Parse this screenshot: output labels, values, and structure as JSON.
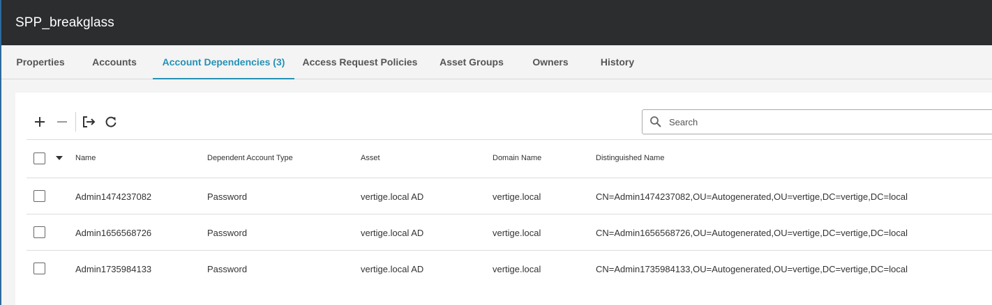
{
  "header": {
    "title": "SPP_breakglass"
  },
  "tabs": [
    {
      "label": "Properties"
    },
    {
      "label": "Accounts"
    },
    {
      "label": "Account Dependencies (3)"
    },
    {
      "label": "Access Request Policies"
    },
    {
      "label": "Asset Groups"
    },
    {
      "label": "Owners"
    },
    {
      "label": "History"
    }
  ],
  "active_tab": "Account Dependencies (3)",
  "toolbar": {
    "icons": [
      "add-icon",
      "remove-icon",
      "export-icon",
      "refresh-icon"
    ]
  },
  "search": {
    "placeholder": "Search",
    "value": ""
  },
  "table": {
    "columns": [
      "Name",
      "Dependent Account Type",
      "Asset",
      "Domain Name",
      "Distinguished Name"
    ],
    "rows": [
      {
        "name": "Admin1474237082",
        "type": "Password",
        "asset": "vertige.local AD",
        "domain": "vertige.local",
        "dn": "CN=Admin1474237082,OU=Autogenerated,OU=vertige,DC=vertige,DC=local"
      },
      {
        "name": "Admin1656568726",
        "type": "Password",
        "asset": "vertige.local AD",
        "domain": "vertige.local",
        "dn": "CN=Admin1656568726,OU=Autogenerated,OU=vertige,DC=vertige,DC=local"
      },
      {
        "name": "Admin1735984133",
        "type": "Password",
        "asset": "vertige.local AD",
        "domain": "vertige.local",
        "dn": "CN=Admin1735984133,OU=Autogenerated,OU=vertige,DC=vertige,DC=local"
      }
    ]
  },
  "colors": {
    "header_bg": "#2b2d2f",
    "accent": "#2491b5",
    "tab_bar_bg": "#f4f4f4"
  }
}
